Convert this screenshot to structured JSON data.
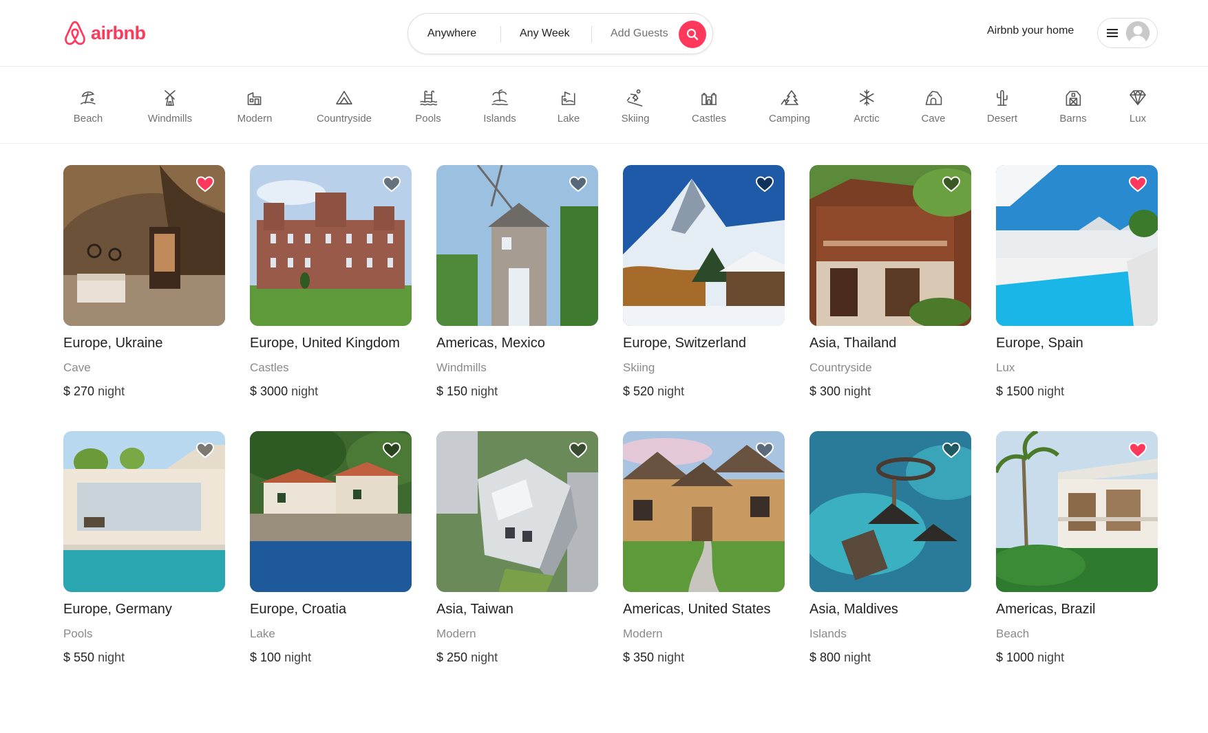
{
  "header": {
    "brand": "airbnb",
    "search": {
      "anywhere": "Anywhere",
      "week": "Any Week",
      "guests": "Add Guests"
    },
    "host_link": "Airbnb your home"
  },
  "categories": [
    {
      "label": "Beach",
      "icon": "beach-icon"
    },
    {
      "label": "Windmills",
      "icon": "windmill-icon"
    },
    {
      "label": "Modern",
      "icon": "modern-house-icon"
    },
    {
      "label": "Countryside",
      "icon": "countryside-icon"
    },
    {
      "label": "Pools",
      "icon": "pool-icon"
    },
    {
      "label": "Islands",
      "icon": "island-icon"
    },
    {
      "label": "Lake",
      "icon": "lake-icon"
    },
    {
      "label": "Skiing",
      "icon": "skiing-icon"
    },
    {
      "label": "Castles",
      "icon": "castle-icon"
    },
    {
      "label": "Camping",
      "icon": "camping-icon"
    },
    {
      "label": "Arctic",
      "icon": "snowflake-icon"
    },
    {
      "label": "Cave",
      "icon": "cave-icon"
    },
    {
      "label": "Desert",
      "icon": "cactus-icon"
    },
    {
      "label": "Barns",
      "icon": "barn-icon"
    },
    {
      "label": "Lux",
      "icon": "diamond-icon"
    }
  ],
  "price_unit": "night",
  "currency": "$",
  "listings": [
    {
      "location": "Europe, Ukraine",
      "category": "Cave",
      "price": "270",
      "favorite": true
    },
    {
      "location": "Europe, United Kingdom",
      "category": "Castles",
      "price": "3000",
      "favorite": false
    },
    {
      "location": "Americas, Mexico",
      "category": "Windmills",
      "price": "150",
      "favorite": false
    },
    {
      "location": "Europe, Switzerland",
      "category": "Skiing",
      "price": "520",
      "favorite": false
    },
    {
      "location": "Asia, Thailand",
      "category": "Countryside",
      "price": "300",
      "favorite": false
    },
    {
      "location": "Europe, Spain",
      "category": "Lux",
      "price": "1500",
      "favorite": true
    },
    {
      "location": "Europe, Germany",
      "category": "Pools",
      "price": "550",
      "favorite": false
    },
    {
      "location": "Europe, Croatia",
      "category": "Lake",
      "price": "100",
      "favorite": false
    },
    {
      "location": "Asia, Taiwan",
      "category": "Modern",
      "price": "250",
      "favorite": false
    },
    {
      "location": "Americas, United States",
      "category": "Modern",
      "price": "350",
      "favorite": false
    },
    {
      "location": "Asia, Maldives",
      "category": "Islands",
      "price": "800",
      "favorite": false
    },
    {
      "location": "Americas, Brazil",
      "category": "Beach",
      "price": "1000",
      "favorite": true
    }
  ],
  "colors": {
    "brand": "#ff385c",
    "favorite_fill": "#ff385c",
    "text_muted": "#717171"
  }
}
